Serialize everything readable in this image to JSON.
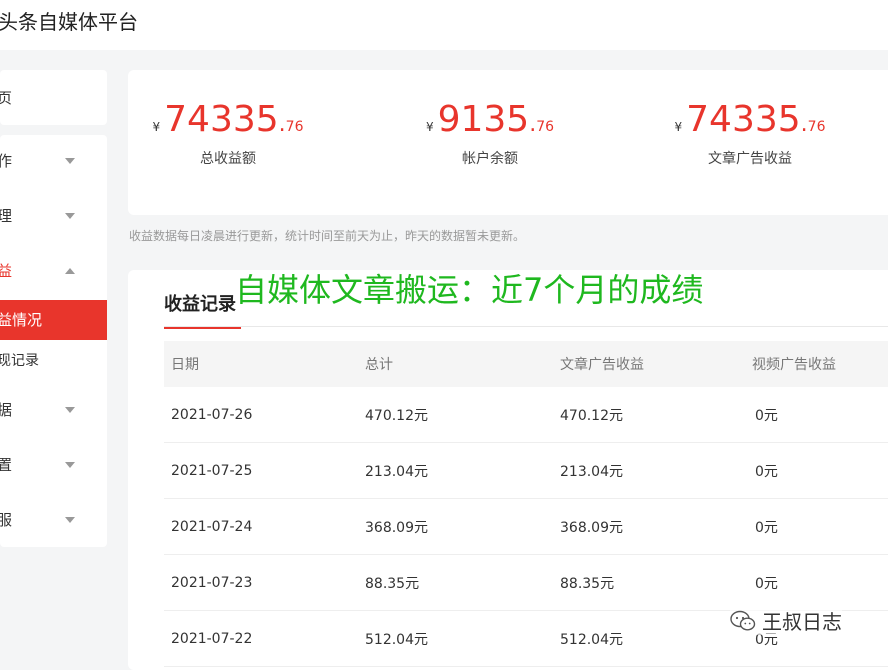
{
  "app": {
    "title": "头条自媒体平台"
  },
  "sidebar": {
    "home_label": "页",
    "items": [
      {
        "label": "作"
      },
      {
        "label": "理"
      },
      {
        "label": "益"
      },
      {
        "label": "益情况"
      },
      {
        "label": "现记录"
      },
      {
        "label": "据"
      },
      {
        "label": "置"
      },
      {
        "label": "服"
      }
    ]
  },
  "stats": [
    {
      "currency": "¥",
      "int": "74335",
      "dot": ".",
      "dec": "76",
      "label": "总收益额"
    },
    {
      "currency": "¥",
      "int": "9135",
      "dot": ".",
      "dec": "76",
      "label": "帐户余额"
    },
    {
      "currency": "¥",
      "int": "74335",
      "dot": ".",
      "dec": "76",
      "label": "文章广告收益"
    }
  ],
  "notice": "收益数据每日凌晨进行更新，统计时间至前天为止，昨天的数据暂未更新。",
  "records": {
    "tab_label": "收益记录",
    "columns": [
      "日期",
      "总计",
      "文章广告收益",
      "视频广告收益"
    ],
    "rows": [
      [
        "2021-07-26",
        "470.12元",
        "470.12元",
        "0元"
      ],
      [
        "2021-07-25",
        "213.04元",
        "213.04元",
        "0元"
      ],
      [
        "2021-07-24",
        "368.09元",
        "368.09元",
        "0元"
      ],
      [
        "2021-07-23",
        "88.35元",
        "88.35元",
        "0元"
      ],
      [
        "2021-07-22",
        "512.04元",
        "512.04元",
        "0元"
      ]
    ]
  },
  "overlay_caption": "自媒体文章搬运：近7个月的成绩",
  "watermark": "王叔日志",
  "colors": {
    "accent": "#e8352c",
    "caption": "#1fb81f",
    "page_bg": "#f4f5f6"
  }
}
